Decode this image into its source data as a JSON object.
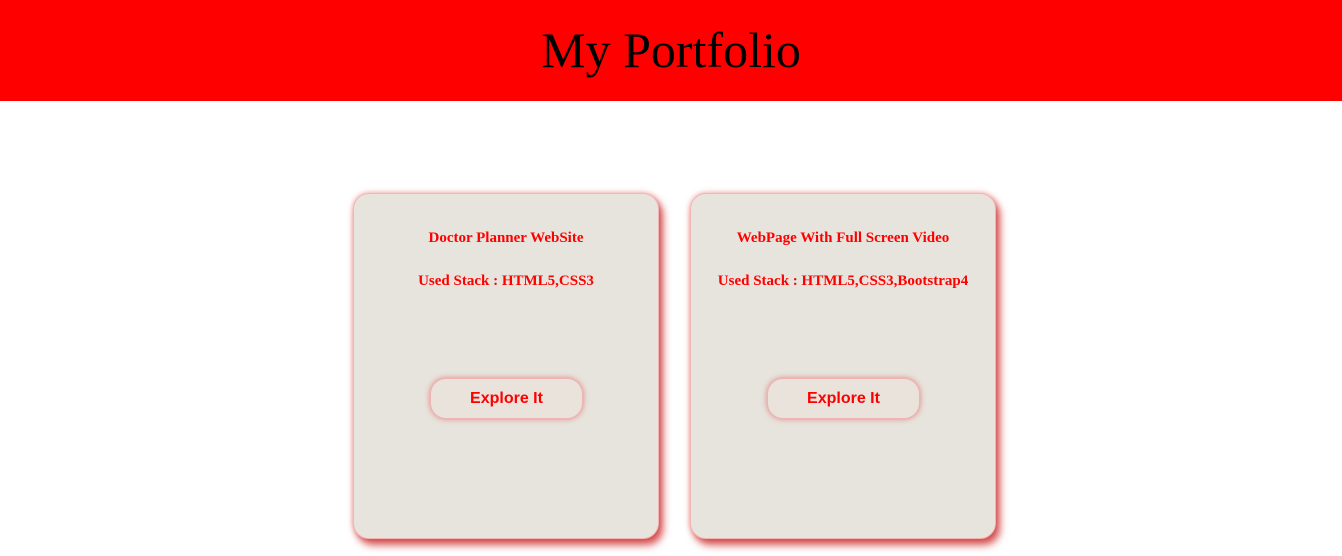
{
  "header": {
    "title": "My Portfolio"
  },
  "cards": [
    {
      "title": "Doctor Planner WebSite",
      "stack": "Used Stack : HTML5,CSS3",
      "button_label": "Explore It"
    },
    {
      "title": "WebPage With Full Screen Video",
      "stack": "Used Stack : HTML5,CSS3,Bootstrap4",
      "button_label": "Explore It"
    }
  ],
  "colors": {
    "header_bg": "#ff0000",
    "card_bg": "#e7e4dd",
    "accent_text": "#ff0000"
  }
}
